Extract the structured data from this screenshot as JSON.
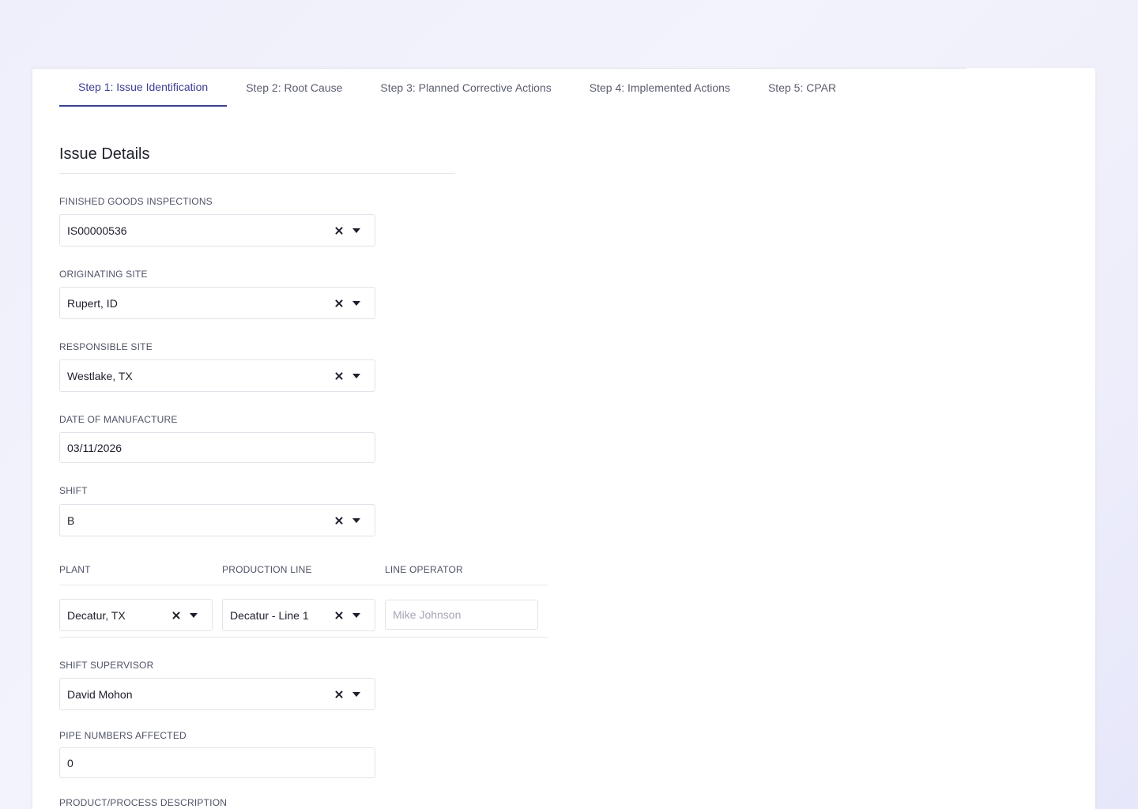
{
  "tabs": [
    {
      "label": "Step 1: Issue Identification",
      "active": true
    },
    {
      "label": "Step 2: Root Cause",
      "active": false
    },
    {
      "label": "Step 3: Planned Corrective Actions",
      "active": false
    },
    {
      "label": "Step 4: Implemented Actions",
      "active": false
    },
    {
      "label": "Step 5: CPAR",
      "active": false
    }
  ],
  "section": {
    "title": "Issue Details"
  },
  "fields": {
    "inspections": {
      "label": "FINISHED GOODS INSPECTIONS",
      "value": "IS00000536"
    },
    "originating_site": {
      "label": "ORIGINATING SITE",
      "value": "Rupert, ID"
    },
    "responsible_site": {
      "label": "RESPONSIBLE SITE",
      "value": "Westlake, TX"
    },
    "date_of_manufacture": {
      "label": "DATE OF MANUFACTURE",
      "value": "03/11/2026"
    },
    "shift": {
      "label": "SHIFT",
      "value": "B"
    },
    "plant": {
      "label": "PLANT",
      "value": "Decatur, TX"
    },
    "production_line": {
      "label": "PRODUCTION LINE",
      "value": "Decatur - Line 1"
    },
    "line_operator": {
      "label": "LINE OPERATOR",
      "placeholder": "Mike Johnson"
    },
    "shift_supervisor": {
      "label": "SHIFT SUPERVISOR",
      "value": "David Mohon"
    },
    "pipe_numbers": {
      "label": "PIPE NUMBERS AFFECTED",
      "value": "0"
    },
    "product_description": {
      "label": "PRODUCT/PROCESS DESCRIPTION"
    }
  },
  "colors": {
    "accent": "#3c3f93",
    "text": "#1d1f2b",
    "label": "#4f5366"
  }
}
